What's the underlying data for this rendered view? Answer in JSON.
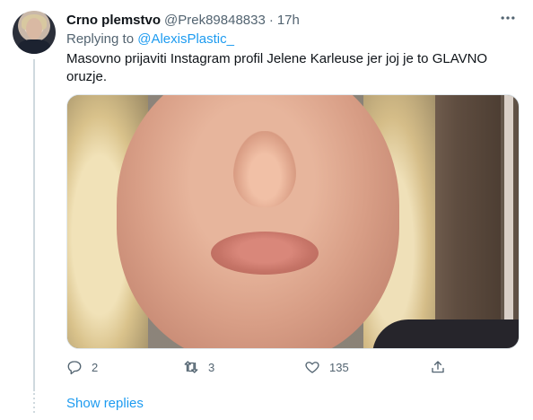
{
  "tweet": {
    "author_name": "Crno plemstvo",
    "author_handle": "@Prek89848833",
    "separator": "·",
    "timestamp": "17h",
    "reply_prefix": "Replying to",
    "reply_to_handle": "@AlexisPlastic_",
    "text": "Masovno prijaviti Instagram profil Jelene Karleuse jer joj je to GLAVNO oruzje.",
    "more_icon": "more-horizontal-icon",
    "actions": {
      "replies": "2",
      "retweets": "3",
      "likes": "135"
    }
  },
  "thread": {
    "show_replies_label": "Show replies"
  },
  "colors": {
    "accent": "#1d9bf0",
    "secondary_text": "#536471",
    "primary_text": "#0f1419"
  }
}
